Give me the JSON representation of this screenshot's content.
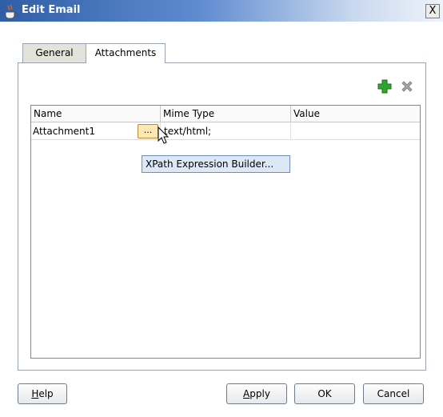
{
  "window": {
    "title": "Edit Email",
    "close_label": "X"
  },
  "tabs": [
    {
      "label": "General"
    },
    {
      "label": "Attachments"
    }
  ],
  "toolbar": {
    "add_icon": "plus-icon",
    "remove_icon": "close-x-icon"
  },
  "table": {
    "columns": [
      "Name",
      "Mime Type",
      "Value"
    ],
    "rows": [
      {
        "name": "Attachment1",
        "mime_type": "text/html;",
        "value": ""
      }
    ],
    "ellipsis_label": "..."
  },
  "tooltip": {
    "text": "XPath Expression Builder..."
  },
  "buttons": {
    "help": {
      "label": "Help",
      "mnemonic": "H",
      "rest": "elp"
    },
    "apply": {
      "label": "Apply",
      "mnemonic": "A",
      "rest": "pply"
    },
    "ok": {
      "label": "OK"
    },
    "cancel": {
      "label": "Cancel"
    }
  },
  "colors": {
    "title_gradient_start": "#2f5ea6",
    "add_icon": "#2fa52f",
    "remove_icon": "#9a9a9a",
    "tooltip_bg": "#dde8f6",
    "ellipsis_bg": "#fde7b3"
  }
}
